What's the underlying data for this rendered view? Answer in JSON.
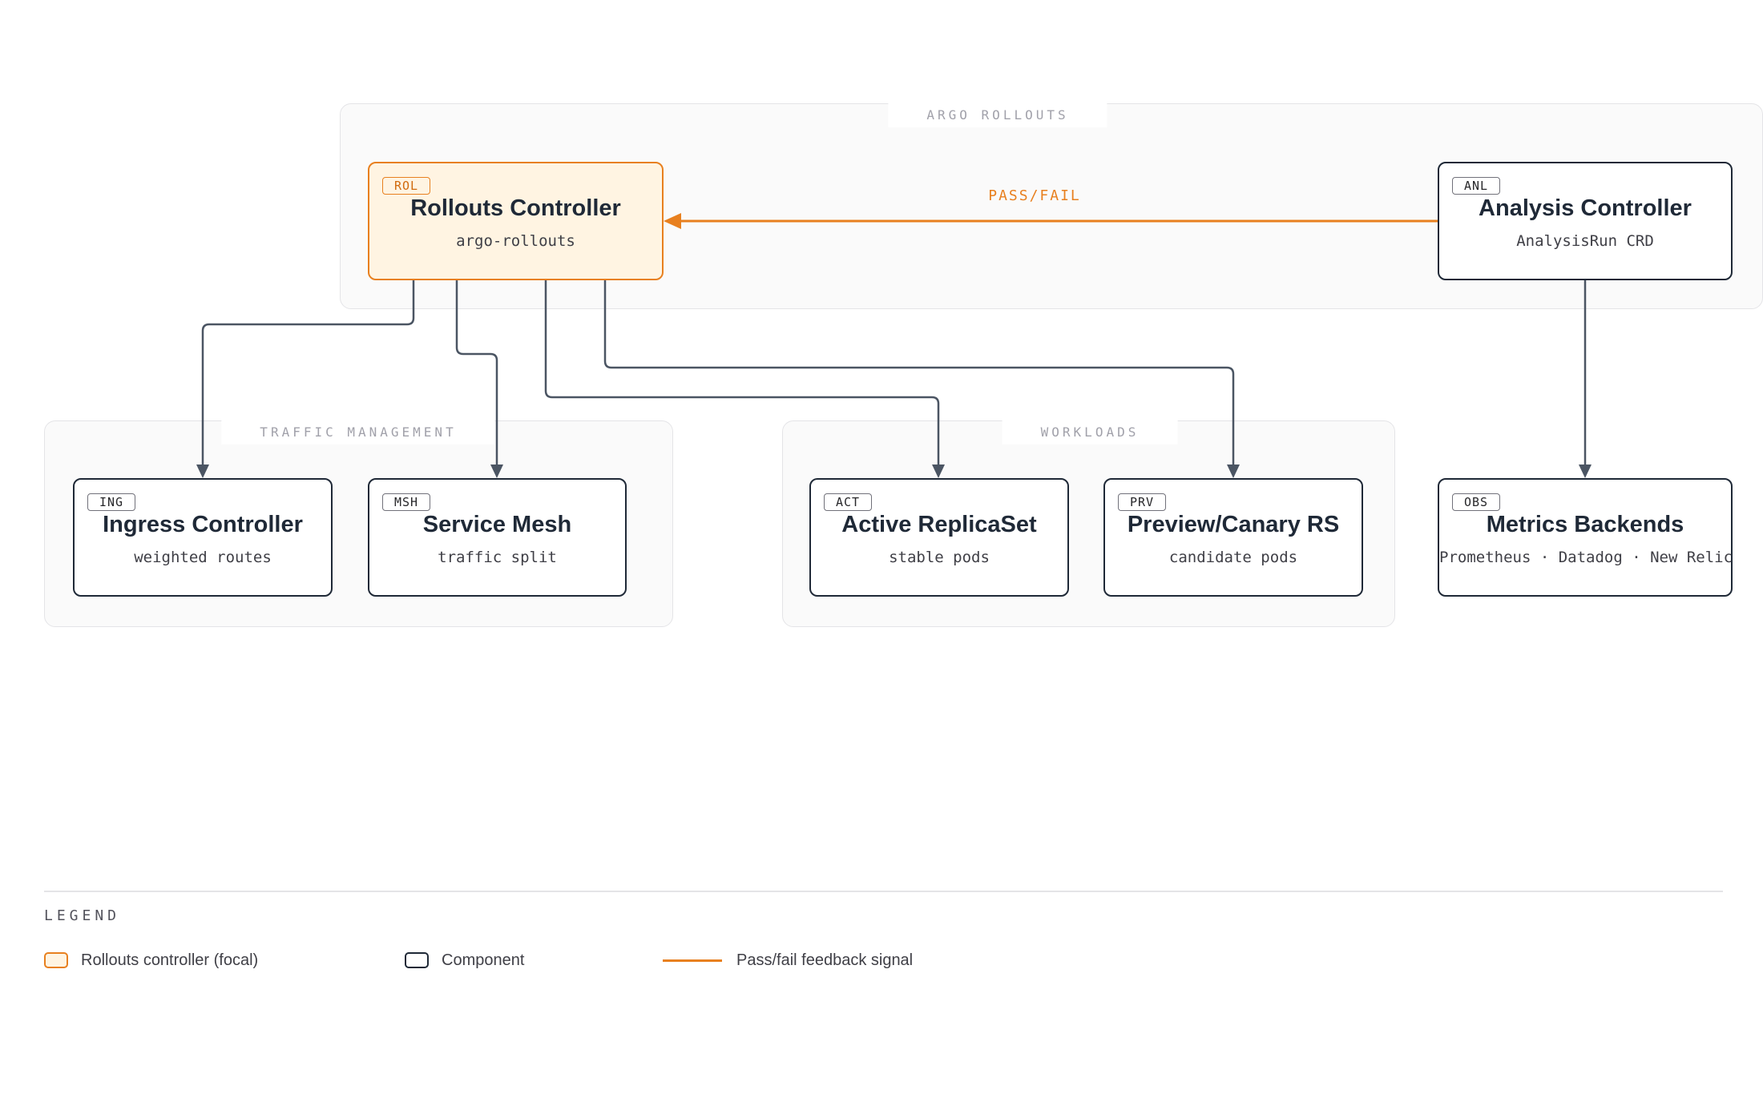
{
  "groups": {
    "argo": {
      "label": "ARGO ROLLOUTS"
    },
    "traffic": {
      "label": "TRAFFIC MANAGEMENT"
    },
    "workloads": {
      "label": "WORKLOADS"
    }
  },
  "nodes": {
    "rol": {
      "tag": "ROL",
      "title": "Rollouts Controller",
      "subtitle": "argo-rollouts"
    },
    "anl": {
      "tag": "ANL",
      "title": "Analysis Controller",
      "subtitle": "AnalysisRun CRD"
    },
    "ing": {
      "tag": "ING",
      "title": "Ingress Controller",
      "subtitle": "weighted routes"
    },
    "msh": {
      "tag": "MSH",
      "title": "Service Mesh",
      "subtitle": "traffic split"
    },
    "act": {
      "tag": "ACT",
      "title": "Active ReplicaSet",
      "subtitle": "stable pods"
    },
    "prv": {
      "tag": "PRV",
      "title": "Preview/Canary RS",
      "subtitle": "candidate pods"
    },
    "obs": {
      "tag": "OBS",
      "title": "Metrics Backends",
      "subtitle": "Prometheus · Datadog · New Relic"
    }
  },
  "edges": {
    "feedback": {
      "label": "PASS/FAIL"
    }
  },
  "legend": {
    "title": "LEGEND",
    "items": [
      {
        "label": "Rollouts controller (focal)"
      },
      {
        "label": "Component"
      },
      {
        "label": "Pass/fail feedback signal"
      }
    ]
  },
  "colors": {
    "accent": "#e8801f",
    "focal_fill": "#fff4e2",
    "node_border": "#1f2937",
    "connector": "#4b5563"
  }
}
